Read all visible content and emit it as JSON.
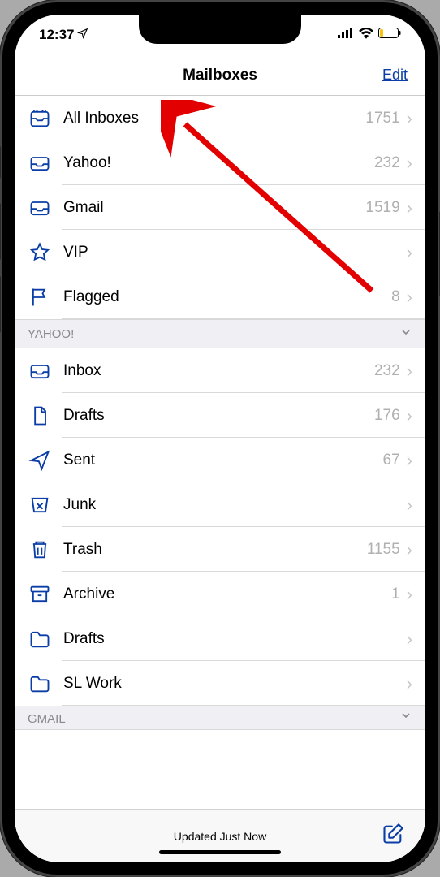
{
  "status": {
    "time": "12:37"
  },
  "nav": {
    "title": "Mailboxes",
    "edit": "Edit"
  },
  "top_rows": [
    {
      "icon": "all-inboxes-icon",
      "label": "All Inboxes",
      "count": "1751"
    },
    {
      "icon": "inbox-icon",
      "label": "Yahoo!",
      "count": "232"
    },
    {
      "icon": "inbox-icon",
      "label": "Gmail",
      "count": "1519"
    },
    {
      "icon": "star-icon",
      "label": "VIP",
      "count": ""
    },
    {
      "icon": "flag-icon",
      "label": "Flagged",
      "count": "8"
    }
  ],
  "sections": [
    {
      "title": "YAHOO!",
      "rows": [
        {
          "icon": "inbox-icon",
          "label": "Inbox",
          "count": "232"
        },
        {
          "icon": "drafts-icon",
          "label": "Drafts",
          "count": "176"
        },
        {
          "icon": "sent-icon",
          "label": "Sent",
          "count": "67"
        },
        {
          "icon": "junk-icon",
          "label": "Junk",
          "count": ""
        },
        {
          "icon": "trash-icon",
          "label": "Trash",
          "count": "1155"
        },
        {
          "icon": "archive-icon",
          "label": "Archive",
          "count": "1"
        },
        {
          "icon": "folder-icon",
          "label": "Drafts",
          "count": ""
        },
        {
          "icon": "folder-icon",
          "label": "SL Work",
          "count": ""
        }
      ]
    },
    {
      "title": "GMAIL",
      "rows": []
    }
  ],
  "toolbar": {
    "status": "Updated Just Now"
  }
}
